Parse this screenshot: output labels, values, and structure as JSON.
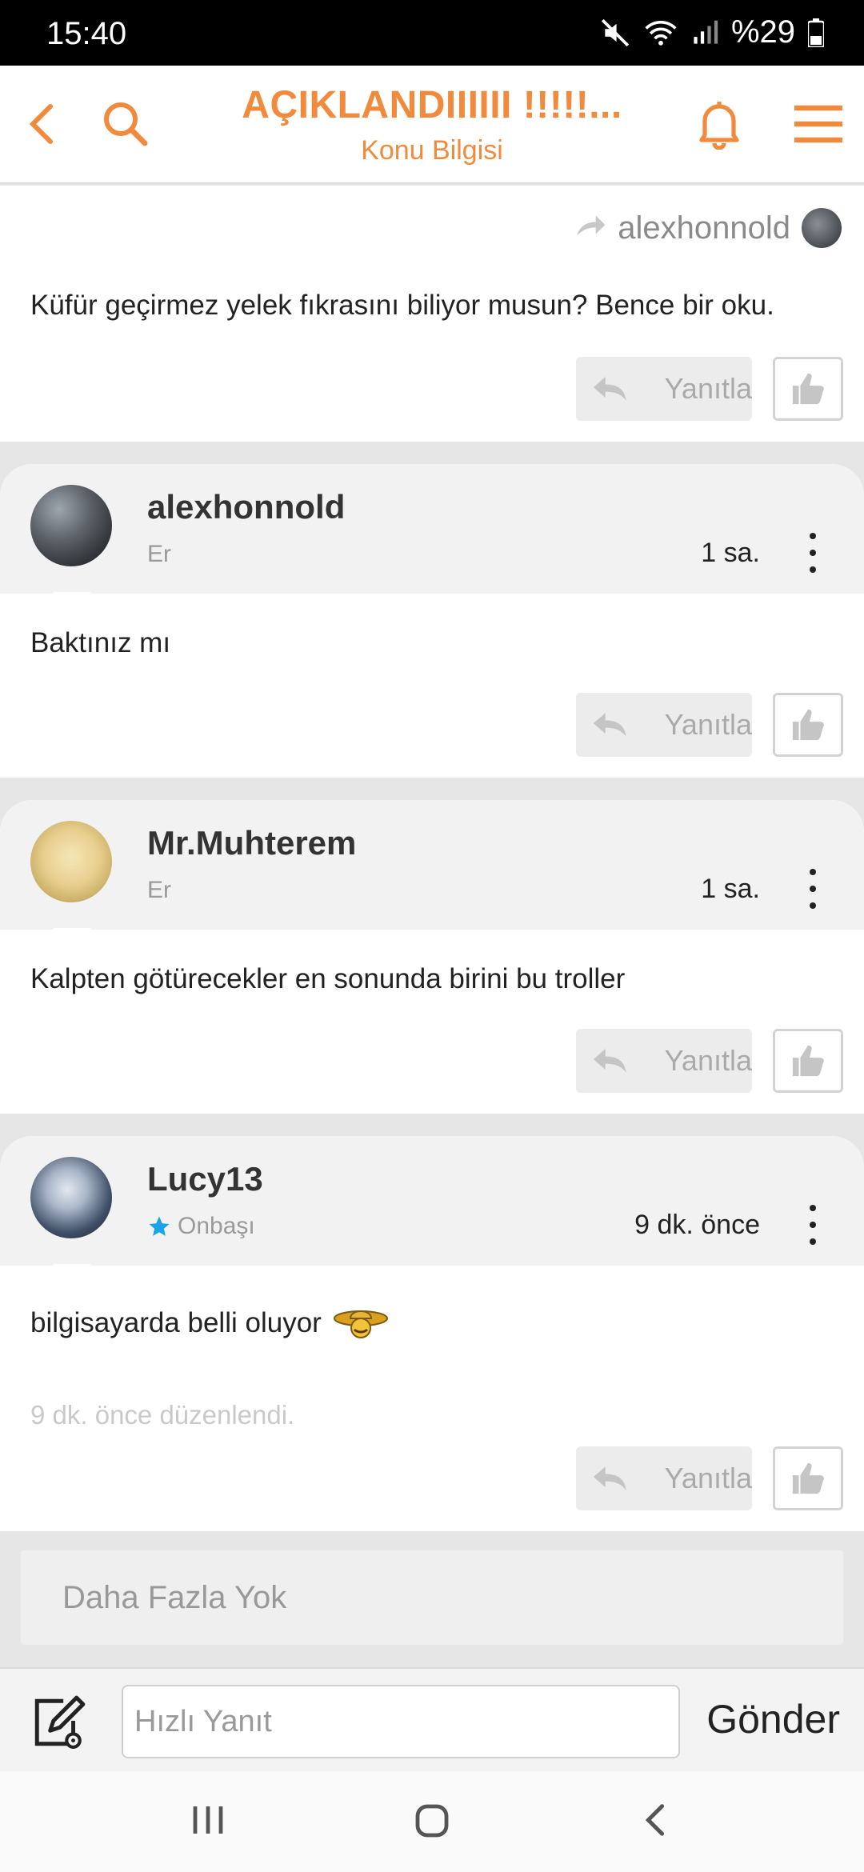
{
  "status_bar": {
    "time": "15:40",
    "battery": "%29",
    "icons": [
      "mute-icon",
      "wifi-icon",
      "signal-icon",
      "battery-icon"
    ]
  },
  "header": {
    "title": "AÇIKLANDIIIIII !!!!!...",
    "subtitle": "Konu Bilgisi",
    "icons": [
      "back-icon",
      "search-icon",
      "bell-icon",
      "menu-icon"
    ],
    "accent_color": "#f08a3c"
  },
  "first_post": {
    "quoted_user": "alexhonnold",
    "text": "Küfür geçirmez yelek fıkrasını biliyor musun? Bence bir oku.",
    "reply_label": "Yanıtla"
  },
  "posts": [
    {
      "username": "alexhonnold",
      "rank": "Er",
      "time": "1 sa.",
      "text": "Baktınız mı",
      "reply_label": "Yanıtla"
    },
    {
      "username": "Mr.Muhterem",
      "rank": "Er",
      "time": "1 sa.",
      "text": "Kalpten götürecekler en sonunda birini bu troller",
      "reply_label": "Yanıtla"
    },
    {
      "username": "Lucy13",
      "rank": "Onbaşı",
      "time": "9 dk. önce",
      "text": "bilgisayarda belli oluyor",
      "edited": "9 dk. önce düzenlendi.",
      "reply_label": "Yanıtla"
    }
  ],
  "footer": {
    "no_more": "Daha Fazla Yok",
    "quick_reply_placeholder": "Hızlı Yanıt",
    "send_label": "Gönder"
  }
}
